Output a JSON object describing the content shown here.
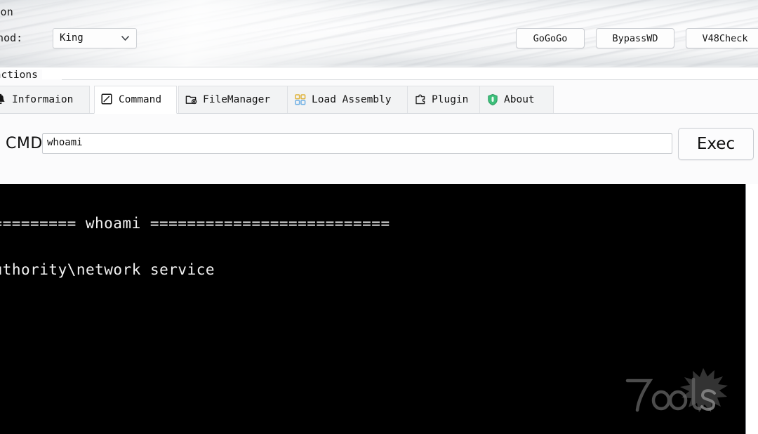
{
  "window": {
    "connection_group_label": "tion",
    "functions_group_label": "unctions"
  },
  "connection": {
    "method_label": "ethod:",
    "method_value": "King",
    "chevron_icon": "chevron-down-icon",
    "buttons": [
      {
        "id": "gogogo",
        "label": "GoGoGo"
      },
      {
        "id": "bypasswd",
        "label": "BypassWD"
      },
      {
        "id": "v48check",
        "label": "V48Check"
      }
    ]
  },
  "tabs": [
    {
      "id": "information",
      "label": "Informaion",
      "icon": "bell-icon",
      "active": false
    },
    {
      "id": "command",
      "label": "Command",
      "icon": "checkbox-icon",
      "active": true
    },
    {
      "id": "filemanager",
      "label": "FileManager",
      "icon": "folder-gear-icon",
      "active": false
    },
    {
      "id": "loadassembly",
      "label": "Load Assembly",
      "icon": "grid-blocks-icon",
      "active": false
    },
    {
      "id": "plugin",
      "label": "Plugin",
      "icon": "puzzle-piece-icon",
      "active": false
    },
    {
      "id": "about",
      "label": "About",
      "icon": "shield-icon",
      "active": false
    }
  ],
  "command_panel": {
    "cmd_label": "CMD",
    "cmd_value": "whoami",
    "cmd_placeholder": "",
    "exec_label": "Exec"
  },
  "console": {
    "background": "#000000",
    "foreground": "#f2f2f2",
    "lines": [
      "========================== whoami ==========================",
      "nt authority\\network service"
    ],
    "watermark": "7ools"
  },
  "colors": {
    "band_top": "#e9ecee",
    "panel": "#fbfbfc",
    "tab_inactive": "#f2f3f4",
    "tab_active": "#ffffff",
    "border": "#d6d9dd",
    "shield_green": "#3dbf7a",
    "assembly_yellow": "#e6b93c",
    "assembly_blue": "#7ab7e8"
  }
}
